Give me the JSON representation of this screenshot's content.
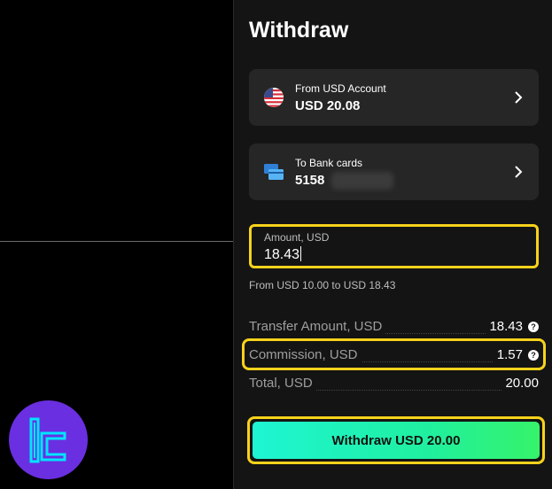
{
  "title": "Withdraw",
  "from": {
    "label": "From USD Account",
    "value": "USD 20.08"
  },
  "to": {
    "label": "To Bank cards",
    "value": "5158"
  },
  "amount": {
    "label": "Amount, USD",
    "value": "18.43",
    "range": "From USD 10.00 to USD 18.43"
  },
  "summary": {
    "transfer": {
      "label": "Transfer Amount, USD",
      "value": "18.43"
    },
    "commission": {
      "label": "Commission, USD",
      "value": "1.57"
    },
    "total": {
      "label": "Total, USD",
      "value": "20.00"
    }
  },
  "button": {
    "label": "Withdraw USD 20.00"
  },
  "icons": {
    "from": "us-flag-icon",
    "to": "bank-cards-icon",
    "chevron": "chevron-right-icon",
    "help": "question-icon",
    "logo": "brand-logo-icon"
  },
  "colors": {
    "accent_highlight": "#f7d21c",
    "logo_bg": "#6a2fe0",
    "logo_mark": "#00e5ff"
  }
}
